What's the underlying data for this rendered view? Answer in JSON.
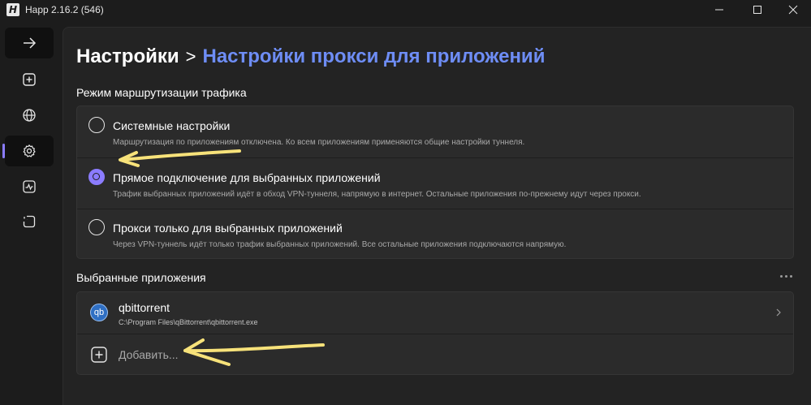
{
  "window": {
    "logo_letter": "H",
    "title": "Happ 2.16.2 (546)"
  },
  "sidebar": {
    "items": [
      {
        "name": "connect",
        "icon": "arrow-right-icon"
      },
      {
        "name": "add",
        "icon": "plus-square-icon"
      },
      {
        "name": "servers",
        "icon": "globe-icon"
      },
      {
        "name": "settings",
        "icon": "gear-icon",
        "active": true
      },
      {
        "name": "stats",
        "icon": "activity-icon"
      },
      {
        "name": "logs",
        "icon": "bracket-icon"
      }
    ]
  },
  "header": {
    "root": "Настройки",
    "separator": ">",
    "current": "Настройки прокси для приложений"
  },
  "routing": {
    "section_title": "Режим маршрутизации трафика",
    "options": [
      {
        "label": "Системные настройки",
        "description": "Маршрутизация по приложениям отключена. Ко всем приложениям применяются общие настройки туннеля.",
        "selected": false
      },
      {
        "label": "Прямое подключение для выбранных приложений",
        "description": "Трафик выбранных приложений идёт в обход VPN-туннеля, напрямую в интернет. Остальные приложения по-прежнему идут через прокси.",
        "selected": true
      },
      {
        "label": "Прокси только для выбранных приложений",
        "description": "Через VPN-туннель идёт только трафик выбранных приложений. Все остальные приложения подключаются напрямую.",
        "selected": false
      }
    ]
  },
  "apps": {
    "section_title": "Выбранные приложения",
    "items": [
      {
        "avatar": "qb",
        "name": "qbittorrent",
        "path": "C:\\Program Files\\qBittorrent\\qbittorrent.exe"
      }
    ],
    "add_label": "Добавить..."
  },
  "colors": {
    "accent": "#8b7cff",
    "title_accent": "#6e8df5",
    "background": "#1c1c1c",
    "card": "#2b2b2b",
    "annotation": "#f7e27a"
  }
}
